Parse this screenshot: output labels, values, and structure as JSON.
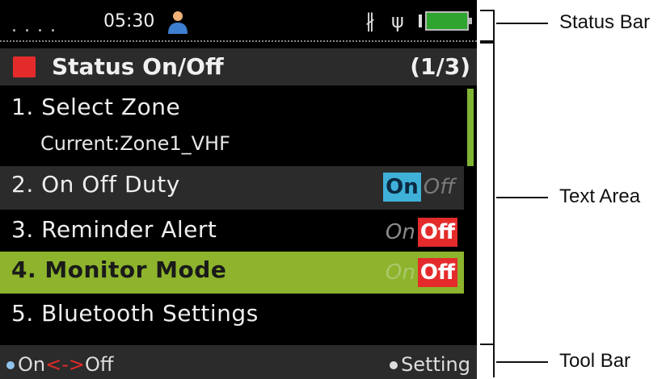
{
  "status_bar": {
    "signal_dots": ". . . .",
    "time": "05:30",
    "icons": [
      "person-icon",
      "bluetooth-icon",
      "usb-icon",
      "battery-icon"
    ]
  },
  "header": {
    "title": "Status On/Off",
    "page": "(1/3)"
  },
  "menu": [
    {
      "label": "1. Select Zone",
      "sub": "Current:Zone1_VHF"
    },
    {
      "label": "2. On Off Duty",
      "on": "On",
      "off": "Off",
      "state": "on"
    },
    {
      "label": "3. Reminder Alert",
      "on": "On",
      "off": "Off",
      "state": "off"
    },
    {
      "label": "4. Monitor Mode",
      "on": "On",
      "off": "Off",
      "state": "off",
      "selected": true
    },
    {
      "label": "5. Bluetooth Settings"
    }
  ],
  "toolbar": {
    "left_on": "On",
    "left_arrow": "<->",
    "left_off": "Off",
    "right": "Setting"
  },
  "annotations": {
    "status_bar": "Status Bar",
    "text_area": "Text Area",
    "tool_bar": "Tool Bar"
  },
  "colors": {
    "accent_red": "#e42b2b",
    "highlight_green": "#8db42c",
    "on_blue": "#3fb1d9",
    "battery_green": "#2fa52f"
  }
}
